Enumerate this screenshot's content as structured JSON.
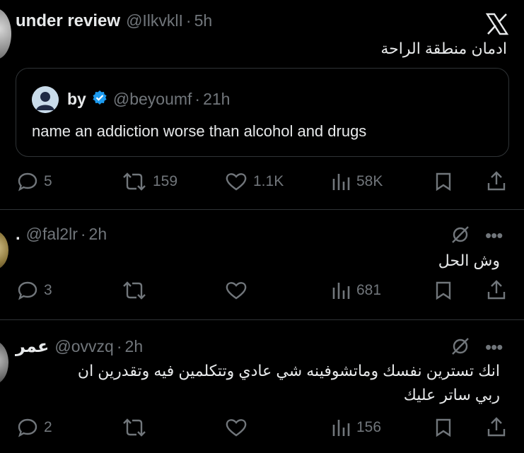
{
  "colors": {
    "background": "#000000",
    "text": "#e7e9ea",
    "muted": "#71767b",
    "verified": "#1d9bf0"
  },
  "close_icon": "x-close-icon",
  "tweet1": {
    "name": "under review",
    "handle": "@IlkvklI",
    "time": "5h",
    "text": "ادمان منطقة الراحة",
    "quote": {
      "name": "by",
      "handle": "@beyoumf",
      "time": "21h",
      "text": "name an addiction worse than alcohol and drugs"
    },
    "replies": "5",
    "retweets": "159",
    "likes": "1.1K",
    "views": "58K"
  },
  "reply1": {
    "name": ".",
    "handle": "@fal2lr",
    "time": "2h",
    "text": "وش الحل",
    "replies": "3",
    "views": "681"
  },
  "reply2": {
    "name": "عمر",
    "handle": "@ovvzq",
    "time": "2h",
    "text_line1": "انك تسترين نفسك وماتشوفينه شي عادي وتتكلمين فيه وتقدرين ان",
    "text_line2": "ربي ساتر عليك",
    "replies": "2",
    "views": "156"
  },
  "dot_separator": "·"
}
